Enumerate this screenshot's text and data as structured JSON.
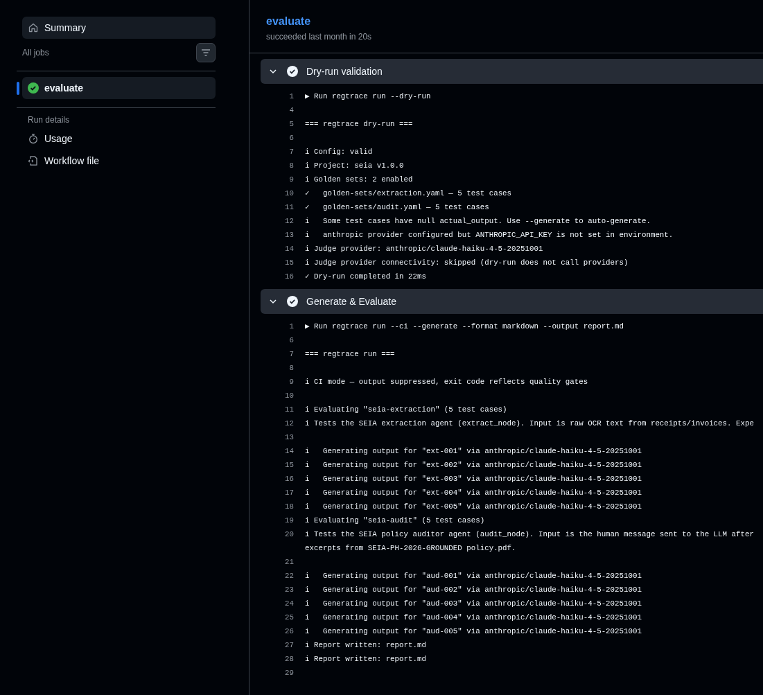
{
  "sidebar": {
    "summary": {
      "label": "Summary",
      "selected": false
    },
    "jobs_label": "All jobs",
    "jobs": [
      {
        "name": "evaluate",
        "kind": "success",
        "selected": true
      }
    ],
    "details_label": "Run details",
    "details": [
      {
        "label": "Usage",
        "kind": "usage"
      },
      {
        "label": "Workflow file",
        "kind": "workflow"
      }
    ]
  },
  "job": {
    "title": "evaluate",
    "subtitle": "succeeded last month in 20s"
  },
  "steps": [
    {
      "title": "Dry-run validation",
      "kind": "success",
      "expanded": true,
      "lines": [
        {
          "n": "1",
          "text": "▶ Run regtrace run --dry-run"
        },
        {
          "n": "4"
        },
        {
          "n": "5",
          "text": "=== regtrace dry-run ==="
        },
        {
          "n": "6"
        },
        {
          "n": "7",
          "text": "i Config: valid"
        },
        {
          "n": "8",
          "text": "i Project: seia v1.0.0"
        },
        {
          "n": "9",
          "text": "i Golden sets: 2 enabled"
        },
        {
          "n": "10",
          "text": "✓   golden-sets/extraction.yaml — 5 test cases"
        },
        {
          "n": "11",
          "text": "✓   golden-sets/audit.yaml — 5 test cases"
        },
        {
          "n": "12",
          "text": "i   Some test cases have null actual_output. Use --generate to auto-generate."
        },
        {
          "n": "13",
          "text": "i   anthropic provider configured but ANTHROPIC_API_KEY is not set in environment."
        },
        {
          "n": "14",
          "text": "i Judge provider: anthropic/claude-haiku-4-5-20251001"
        },
        {
          "n": "15",
          "text": "i Judge provider connectivity: skipped (dry-run does not call providers)"
        },
        {
          "n": "16",
          "text": "✓ Dry-run completed in 22ms"
        }
      ]
    },
    {
      "title": "Generate & Evaluate",
      "kind": "success",
      "expanded": true,
      "lines": [
        {
          "n": "1",
          "text": "▶ Run regtrace run --ci --generate --format markdown --output report.md"
        },
        {
          "n": "6"
        },
        {
          "n": "7",
          "text": "=== regtrace run ==="
        },
        {
          "n": "8"
        },
        {
          "n": "9",
          "text": "i CI mode — output suppressed, exit code reflects quality gates"
        },
        {
          "n": "10"
        },
        {
          "n": "11",
          "text": "i Evaluating \"seia-extraction\" (5 test cases)"
        },
        {
          "n": "12",
          "text": "i Tests the SEIA extraction agent (extract_node). Input is raw OCR text from receipts/invoices. Expe"
        },
        {
          "n": "13"
        },
        {
          "n": "14",
          "text": "i   Generating output for \"ext-001\" via anthropic/claude-haiku-4-5-20251001"
        },
        {
          "n": "15",
          "text": "i   Generating output for \"ext-002\" via anthropic/claude-haiku-4-5-20251001"
        },
        {
          "n": "16",
          "text": "i   Generating output for \"ext-003\" via anthropic/claude-haiku-4-5-20251001"
        },
        {
          "n": "17",
          "text": "i   Generating output for \"ext-004\" via anthropic/claude-haiku-4-5-20251001"
        },
        {
          "n": "18",
          "text": "i   Generating output for \"ext-005\" via anthropic/claude-haiku-4-5-20251001"
        },
        {
          "n": "19",
          "text": "i Evaluating \"seia-audit\" (5 test cases)"
        },
        {
          "n": "20",
          "text": "i Tests the SEIA policy auditor agent (audit_node). Input is the human message sent to the LLM after",
          "wrap": "excerpts from SEIA-PH-2026-GROUNDED policy.pdf."
        },
        {
          "n": "21"
        },
        {
          "n": "22",
          "text": "i   Generating output for \"aud-001\" via anthropic/claude-haiku-4-5-20251001"
        },
        {
          "n": "23",
          "text": "i   Generating output for \"aud-002\" via anthropic/claude-haiku-4-5-20251001"
        },
        {
          "n": "24",
          "text": "i   Generating output for \"aud-003\" via anthropic/claude-haiku-4-5-20251001"
        },
        {
          "n": "25",
          "text": "i   Generating output for \"aud-004\" via anthropic/claude-haiku-4-5-20251001"
        },
        {
          "n": "26",
          "text": "i   Generating output for \"aud-005\" via anthropic/claude-haiku-4-5-20251001"
        },
        {
          "n": "27",
          "text": "i Report written: report.md"
        },
        {
          "n": "28",
          "text": "i Report written: report.md"
        },
        {
          "n": "29"
        }
      ]
    }
  ]
}
